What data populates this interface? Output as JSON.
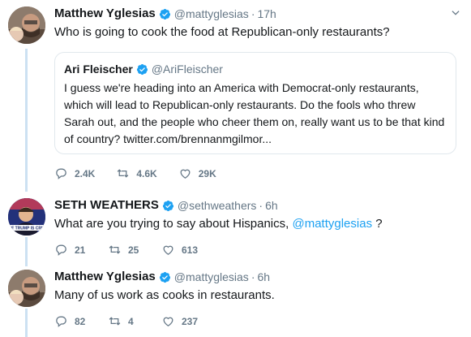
{
  "tweets": [
    {
      "name": "Matthew Yglesias",
      "handle": "@mattyglesias",
      "time": "17h",
      "text": "Who is going to cook the food at Republican-only restaurants?",
      "quote": {
        "name": "Ari Fleischer",
        "handle": "@AriFleischer",
        "text": "I guess we're heading into an America with Democrat-only restaurants, which will lead to Republican-only restaurants.  Do the fools who threw Sarah out, and the people who cheer them on, really want us to be that kind of country? twitter.com/brennanmgilmor..."
      },
      "replies": "2.4K",
      "retweets": "4.6K",
      "likes": "29K"
    },
    {
      "name": "SETH WEATHERS",
      "handle": "@sethweathers",
      "time": "6h",
      "text_before": "What are you trying to say about Hispanics,",
      "mention": "@mattyglesias",
      "text_after": "?",
      "avatar_caption": "OF TRUMP IS CRIS",
      "replies": "21",
      "retweets": "25",
      "likes": "613"
    },
    {
      "name": "Matthew Yglesias",
      "handle": "@mattyglesias",
      "time": "6h",
      "text": "Many of us work as cooks in restaurants.",
      "replies": "82",
      "retweets": "4",
      "likes": "237"
    }
  ],
  "colors": {
    "accent": "#1da1f2",
    "muted": "#657786",
    "thread": "#cce1f2"
  },
  "icons": [
    "reply-icon",
    "retweet-icon",
    "like-icon",
    "verified-icon",
    "chevron-down-icon"
  ],
  "separator": "·"
}
